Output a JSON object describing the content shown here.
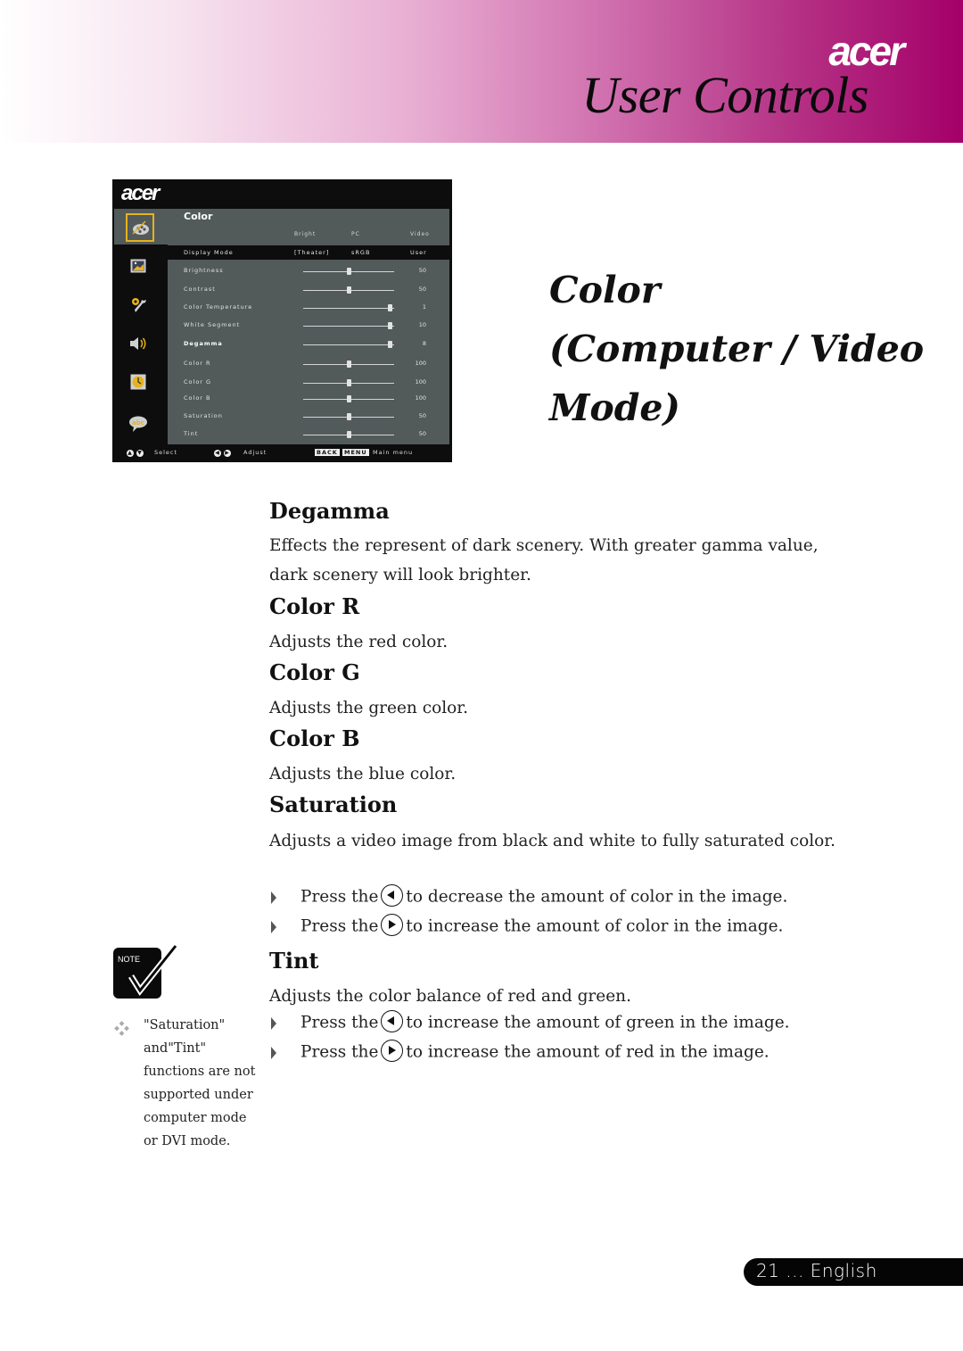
{
  "header": {
    "brand": "acer",
    "title": "User Controls",
    "gradient_colors": [
      "#ffffff",
      "#e9b0d4",
      "#a40068"
    ]
  },
  "osd": {
    "brand": "acer",
    "menu_title": "Color",
    "column_headers": [
      "Bright",
      "PC",
      "Video"
    ],
    "display_mode": {
      "label": "Display Mode",
      "options": [
        "[Theater]",
        "sRGB",
        "User"
      ]
    },
    "sidebar_icons": [
      "color-palette-icon",
      "image-icon",
      "settings-wrench-icon",
      "speaker-icon",
      "clock-icon",
      "language-bubble-icon"
    ],
    "accent_color": "#e6b21e",
    "rows": [
      {
        "label": "Brightness",
        "value": "50",
        "level": 0.5
      },
      {
        "label": "Contrast",
        "value": "50",
        "level": 0.5
      },
      {
        "label": "Color Temperature",
        "value": "1",
        "level": 0.95
      },
      {
        "label": "White Segment",
        "value": "10",
        "level": 0.95
      },
      {
        "label": "Degamma",
        "value": "8",
        "level": 0.95,
        "active": true
      },
      {
        "label": "Color R",
        "value": "100",
        "level": 0.5
      },
      {
        "label": "Color G",
        "value": "100",
        "level": 0.5
      },
      {
        "label": "Color B",
        "value": "100",
        "level": 0.5
      },
      {
        "label": "Saturation",
        "value": "50",
        "level": 0.5
      },
      {
        "label": "Tint",
        "value": "50",
        "level": 0.5
      }
    ],
    "footer": {
      "select": "Select",
      "adjust": "Adjust",
      "back_key": "BACK",
      "menu_key": "MENU",
      "main_menu": "Main menu"
    }
  },
  "section": {
    "title_lines": [
      "Color",
      "(Computer / Video",
      "Mode)"
    ]
  },
  "content": {
    "degamma": {
      "heading": "Degamma",
      "text": "Effects the represent of dark scenery. With greater gamma value, dark scenery will look brighter."
    },
    "color_r": {
      "heading": "Color R",
      "text": "Adjusts the red color."
    },
    "color_g": {
      "heading": "Color G",
      "text": "Adjusts the green color."
    },
    "color_b": {
      "heading": "Color B",
      "text": "Adjusts the blue color."
    },
    "saturation": {
      "heading": "Saturation",
      "text": "Adjusts a video image from black and white to fully saturated color.",
      "bullets": [
        {
          "pre": "Press the",
          "button": "left-arrow",
          "post": "to decrease the amount of color in the image."
        },
        {
          "pre": "Press the",
          "button": "right-arrow",
          "post": "to increase the amount of color in the image."
        }
      ]
    },
    "tint": {
      "heading": "Tint",
      "text": "Adjusts the color balance of red and green.",
      "bullets": [
        {
          "pre": "Press the",
          "button": "left-arrow",
          "post": "to increase the amount of green in the image."
        },
        {
          "pre": "Press the",
          "button": "right-arrow",
          "post": "to increase the amount of red in the image."
        }
      ]
    }
  },
  "note": {
    "label": "NOTE",
    "text": "\"Saturation\" and\"Tint\" functions are not supported under computer mode or DVI mode."
  },
  "footer": {
    "page_label": "21 ... English"
  }
}
